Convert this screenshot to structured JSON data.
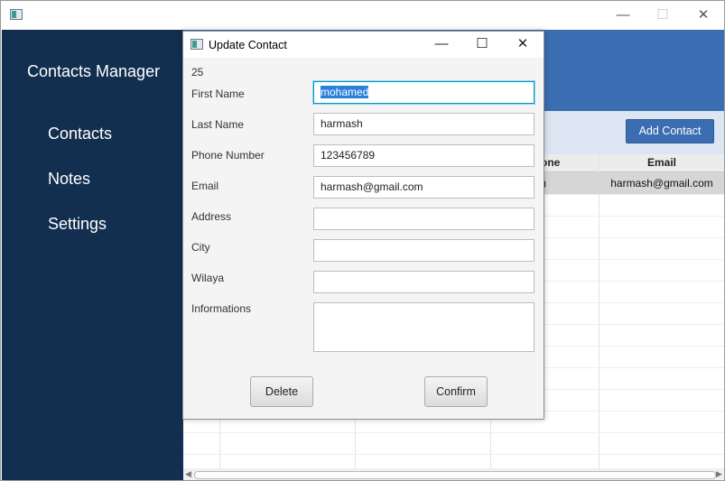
{
  "main_window": {
    "controls": {
      "minimize": "—",
      "maximize": "☐",
      "close": "✕"
    }
  },
  "sidebar": {
    "title": "Contacts Manager",
    "items": [
      {
        "label": "Contacts"
      },
      {
        "label": "Notes"
      },
      {
        "label": "Settings"
      }
    ]
  },
  "toolbar": {
    "add_contact_label": "Add Contact"
  },
  "table": {
    "columns": [
      {
        "label": "one"
      },
      {
        "label": "Email"
      }
    ],
    "rows": [
      {
        "phone_fragment": ")",
        "email": "harmash@gmail.com"
      }
    ]
  },
  "dialog": {
    "title": "Update Contact",
    "controls": {
      "minimize": "—",
      "maximize": "☐",
      "close": "✕"
    },
    "id": "25",
    "fields": {
      "first_name": {
        "label": "First Name",
        "value": "mohamed"
      },
      "last_name": {
        "label": "Last Name",
        "value": "harmash"
      },
      "phone": {
        "label": "Phone Number",
        "value": "123456789"
      },
      "email": {
        "label": "Email",
        "value": "harmash@gmail.com"
      },
      "address": {
        "label": "Address",
        "value": ""
      },
      "city": {
        "label": "City",
        "value": ""
      },
      "wilaya": {
        "label": "Wilaya",
        "value": ""
      },
      "informations": {
        "label": "Informations",
        "value": ""
      }
    },
    "delete_label": "Delete",
    "confirm_label": "Confirm"
  },
  "colors": {
    "sidebar_bg": "#132f50",
    "header_blue": "#3a6db2",
    "toolbar_bg": "#dce5f2",
    "selection": "#2b7fd9"
  }
}
